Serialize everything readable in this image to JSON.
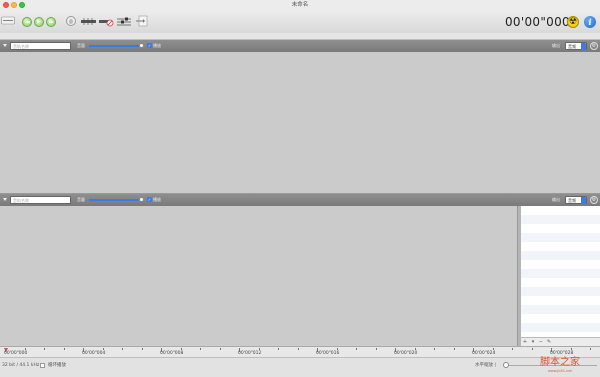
{
  "window": {
    "title": "未命名"
  },
  "toolbar": {
    "timecode": "00'00\"000",
    "buttons": [
      "rewind",
      "play",
      "fast-forward",
      "record",
      "effects",
      "silence",
      "mixer",
      "export"
    ],
    "rewind_glyph": "◀◀",
    "play_glyph": "▶",
    "ff_glyph": "▶▶",
    "info_glyph": "i",
    "radiation_glyph": "☢"
  },
  "track1": {
    "name_placeholder": "音轨名称",
    "volume_label": "音量",
    "mute_label": "播放",
    "output_label": "输出",
    "output_value": "音频",
    "volume_level": 0.96
  },
  "track2": {
    "name_placeholder": "音轨名称",
    "volume_label": "音量",
    "mute_label": "播放",
    "output_label": "输出",
    "output_value": "音频",
    "volume_level": 0.96
  },
  "timeline": {
    "labels": [
      "00'00\"000",
      "00'00\"004",
      "00'00\"008",
      "00'00\"012",
      "00'00\"016",
      "00'00\"020",
      "00'00\"024",
      "00'00\"028"
    ]
  },
  "right_panel": {
    "add": "+",
    "add_menu": "▾",
    "remove": "−",
    "edit": "✎"
  },
  "status": {
    "format": "32 bit / 44.1 kHz",
    "loop_label": "循环播放",
    "zoom_label": "水平缩放 ⟨"
  },
  "watermark": {
    "text": "脚本之家",
    "sub": "www.jb51.net"
  }
}
